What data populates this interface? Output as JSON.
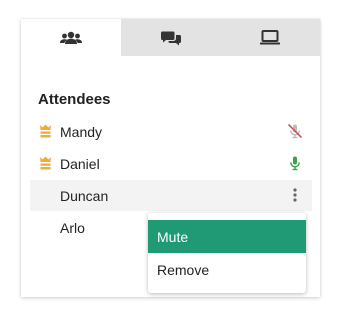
{
  "tabs": [
    {
      "icon": "users-icon",
      "active": true
    },
    {
      "icon": "chat-icon",
      "active": false
    },
    {
      "icon": "screen-icon",
      "active": false
    }
  ],
  "heading": "Attendees",
  "attendees": [
    {
      "name": "Mandy",
      "host": true,
      "mic": "muted"
    },
    {
      "name": "Daniel",
      "host": true,
      "mic": "active"
    },
    {
      "name": "Duncan",
      "host": false,
      "mic": "menu"
    },
    {
      "name": "Arlo",
      "host": false,
      "mic": "none"
    }
  ],
  "context_menu": {
    "items": [
      "Mute",
      "Remove"
    ],
    "selected": "Mute"
  },
  "colors": {
    "accent": "#1f9a74",
    "host_crown": "#f2a93b",
    "mic_active": "#3aa34a",
    "mic_muted": "#d9534f",
    "tab_inactive": "#e3e3e3"
  }
}
